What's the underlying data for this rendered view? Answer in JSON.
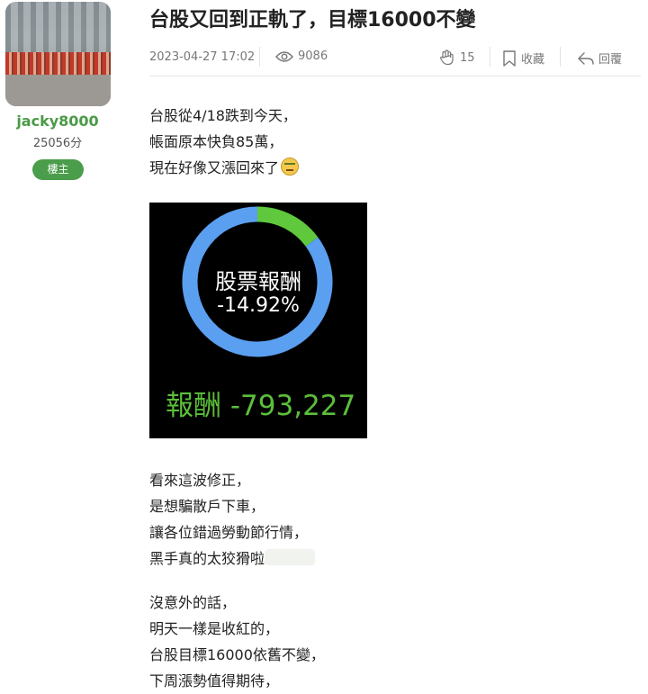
{
  "author": {
    "username": "jacky8000",
    "points": "25056分",
    "badge": "樓主"
  },
  "post": {
    "title": "台股又回到正軌了，目標16000不變",
    "date": "2023-04-27 17:02",
    "views": "9086",
    "likes": "15",
    "bookmark_label": "收藏",
    "reply_label": "回覆"
  },
  "content": {
    "para1": [
      "台股從4/18跌到今天，",
      "帳面原本快負85萬，",
      "現在好像又漲回來了"
    ],
    "para2": [
      "看來這波修正，",
      "是想騙散戶下車，",
      "讓各位錯過勞動節行情，",
      "黑手真的太狡猾啦"
    ],
    "para3": [
      "沒意外的話，",
      "明天一樣是收紅的，",
      "台股目標16000依舊不變，",
      "下周漲勢值得期待，"
    ]
  },
  "chart_data": {
    "type": "pie",
    "title": "股票報酬",
    "center_value": "-14.92%",
    "footer_label": "報酬 -793,227",
    "slices": [
      {
        "value": 14.92,
        "color": "#5fc83c"
      },
      {
        "value": 85.08,
        "color": "#5b9ff0"
      }
    ]
  }
}
